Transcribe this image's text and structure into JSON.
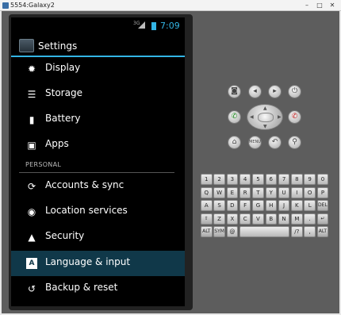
{
  "window": {
    "title": "5554:Galaxy2"
  },
  "status_bar": {
    "network": "3G",
    "time": "7:09"
  },
  "action_bar": {
    "title": "Settings"
  },
  "settings": {
    "items_top": [
      {
        "label": "Display",
        "icon": "brightness-icon"
      },
      {
        "label": "Storage",
        "icon": "storage-icon"
      },
      {
        "label": "Battery",
        "icon": "battery-icon"
      },
      {
        "label": "Apps",
        "icon": "apps-icon"
      }
    ],
    "section_personal": "PERSONAL",
    "items_personal": [
      {
        "label": "Accounts & sync",
        "icon": "sync-icon"
      },
      {
        "label": "Location services",
        "icon": "location-icon"
      },
      {
        "label": "Security",
        "icon": "lock-icon"
      },
      {
        "label": "Language & input",
        "icon": "language-icon",
        "selected": true
      },
      {
        "label": "Backup & reset",
        "icon": "backup-icon"
      }
    ]
  },
  "controls": {
    "menu_label": "MENU",
    "buttons": [
      "camera-icon",
      "volume-down-icon",
      "volume-up-icon",
      "power-icon",
      "call-icon",
      "end-call-icon",
      "home-icon",
      "back-icon",
      "search-icon"
    ]
  },
  "keyboard": {
    "row1": [
      "1",
      "2",
      "3",
      "4",
      "5",
      "6",
      "7",
      "8",
      "9",
      "0"
    ],
    "row2": [
      "Q",
      "W",
      "E",
      "R",
      "T",
      "Y",
      "U",
      "I",
      "O",
      "P"
    ],
    "row3": [
      "A",
      "S",
      "D",
      "F",
      "G",
      "H",
      "J",
      "K",
      "L",
      "DEL"
    ],
    "row4": [
      "Z",
      "X",
      "C",
      "V",
      "B",
      "N",
      "M",
      "."
    ],
    "row5": {
      "alt": "ALT",
      "sym": "SYM",
      "at": "@",
      "space": "",
      "slash": "/?",
      "comma": ",",
      "alt2": "ALT"
    }
  },
  "accent_color": "#33b5e5"
}
